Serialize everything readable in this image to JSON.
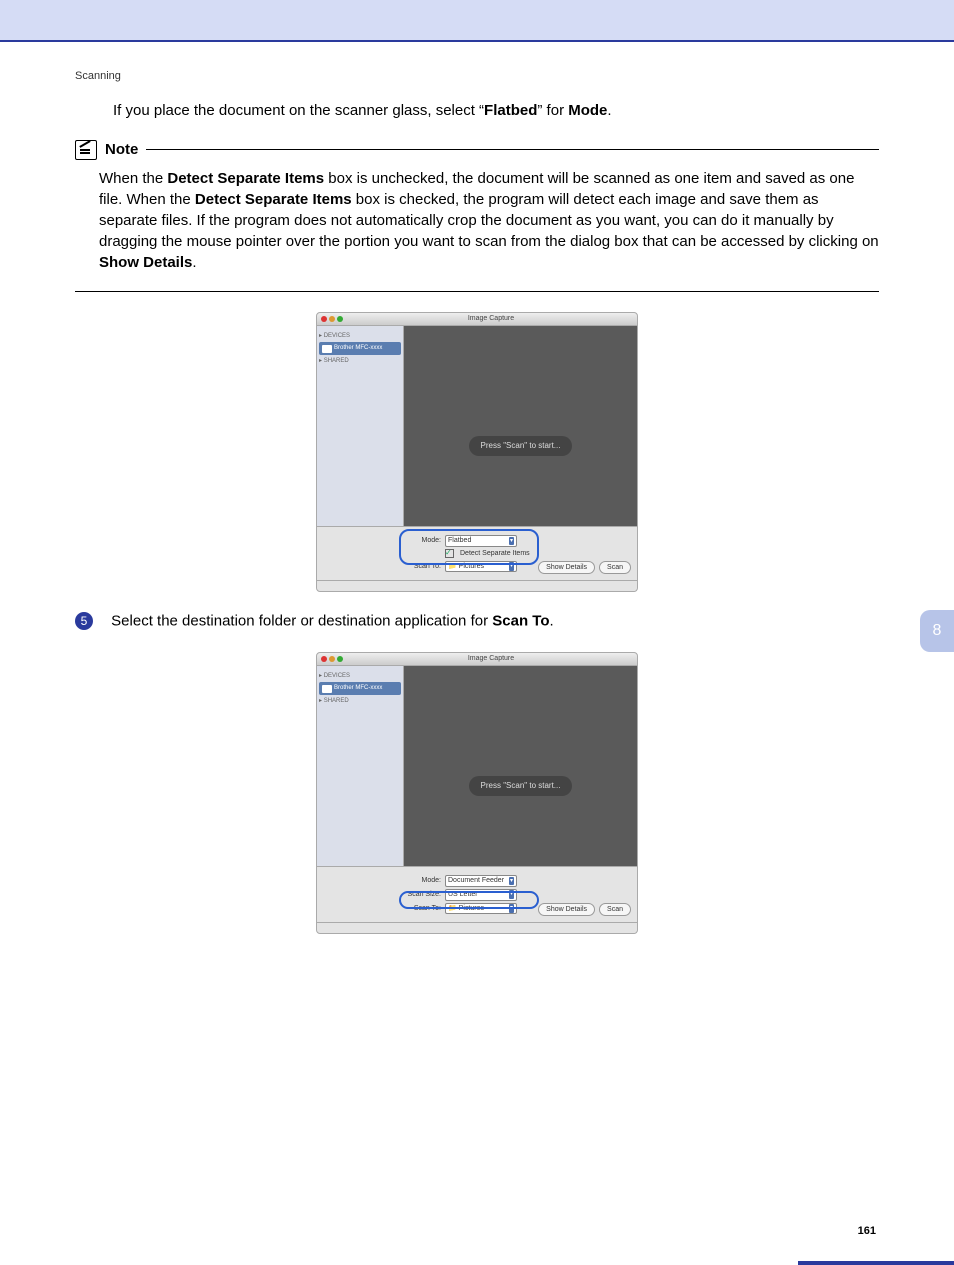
{
  "header": {
    "section": "Scanning"
  },
  "intro": {
    "pre": "If you place the document on the scanner glass, select “",
    "flatbed": "Flatbed",
    "mid": "” for ",
    "mode": "Mode",
    "end": "."
  },
  "note": {
    "title": "Note",
    "t1": "When the ",
    "b1": "Detect Separate Items",
    "t2": " box is unchecked, the document will be scanned as one item and saved as one file. When the ",
    "b2": "Detect Separate Items",
    "t3": " box is checked, the program will detect each image and save them as separate files. If the program does not automatically crop the document as you want, you can do it manually by dragging the mouse pointer over the portion you want to scan from the dialog box that can be accessed by clicking on ",
    "b3": "Show Details",
    "t4": "."
  },
  "step": {
    "num": "5",
    "t1": "Select the destination folder or destination application for ",
    "b1": "Scan To",
    "t2": "."
  },
  "ss": {
    "title": "Image Capture",
    "devcat": "DEVICES",
    "device": "Brother MFC-xxxx",
    "sharecat": "SHARED",
    "scanmsg": "Press \"Scan\" to start...",
    "modeLbl": "Mode:",
    "scansizeLbl": "Scan Size:",
    "scantoLbl": "Scan To:",
    "modeFlatbed": "Flatbed",
    "modeDocFeeder": "Document Feeder",
    "scanSizeVal": "US Letter",
    "scanToVal": "Pictures",
    "detect": "Detect Separate Items",
    "showDetails": "Show Details",
    "scan": "Scan"
  },
  "sidetab": "8",
  "pagenum": "161"
}
